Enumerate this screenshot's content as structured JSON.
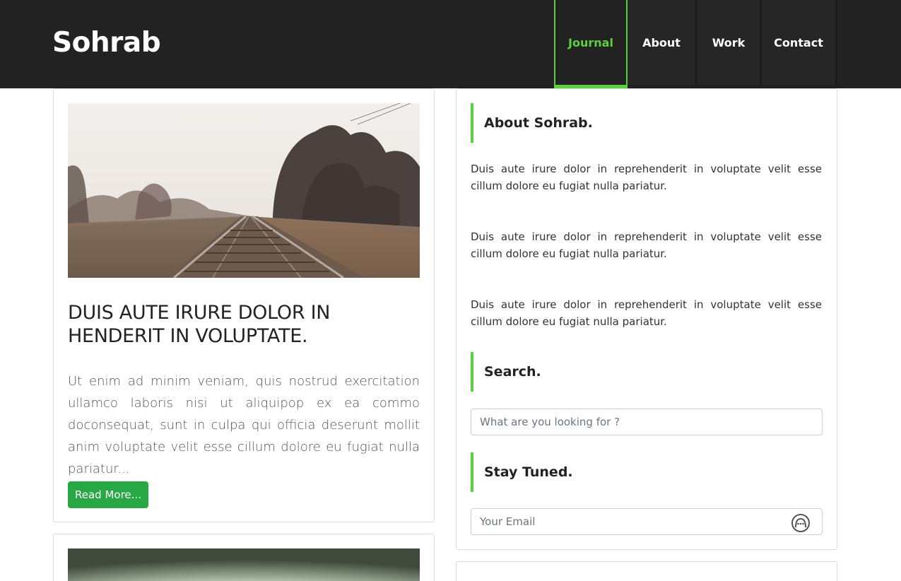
{
  "header": {
    "logo": "Sohrab",
    "nav": [
      {
        "label": "Journal",
        "active": true
      },
      {
        "label": "About",
        "active": false
      },
      {
        "label": "Work",
        "active": false
      },
      {
        "label": "Contact",
        "active": false
      }
    ]
  },
  "post": {
    "title": "DUIS AUTE IRURE DOLOR IN HENDERIT IN VOLUPTATE.",
    "excerpt": "Ut enim ad minim veniam, quis nostrud exercitation ullamco laboris nisi ut aliquipop ex ea commo doconsequat, sunt in culpa qui officia deserunt mollit anim voluptate velit esse cillum dolore eu fugiat nulla pariatur...",
    "read_more": "Read More..."
  },
  "sidebar": {
    "about_title": "About Sohrab.",
    "about_paragraphs": [
      "Duis aute irure dolor in reprehenderit in voluptate velit esse cillum dolore eu fugiat nulla pariatur.",
      "Duis aute irure dolor in reprehenderit in voluptate velit esse cillum dolore eu fugiat nulla pariatur.",
      "Duis aute irure dolor in reprehenderit in voluptate velit esse cillum dolore eu fugiat nulla pariatur."
    ],
    "search_title": "Search.",
    "search_placeholder": "What are you looking for ?",
    "tuned_title": "Stay Tuned.",
    "email_placeholder": "Your Email",
    "send_icon": "chat-bubble-icon"
  },
  "colors": {
    "header_bg": "#222222",
    "accent": "#5cd13f",
    "button": "#28a745"
  }
}
